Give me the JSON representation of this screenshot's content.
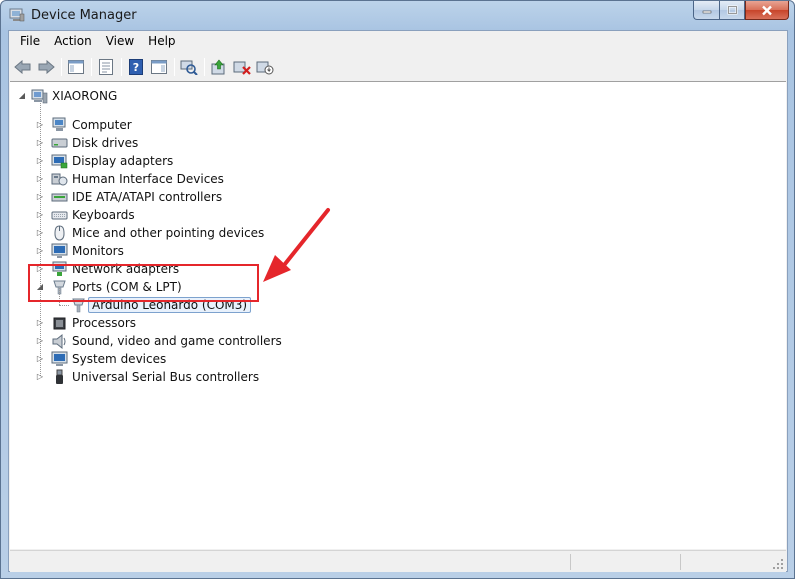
{
  "window": {
    "title": "Device Manager"
  },
  "menu": {
    "file": "File",
    "action": "Action",
    "view": "View",
    "help": "Help"
  },
  "toolbar": {
    "buttons": [
      "back-icon",
      "forward-icon",
      "show-hide-tree-icon",
      "properties-icon",
      "help-icon",
      "action-pane-icon",
      "scan-hardware-icon",
      "update-driver-icon",
      "uninstall-icon",
      "disable-icon"
    ]
  },
  "tree": {
    "root": "XIAORONG",
    "items": [
      {
        "label": "Computer",
        "icon": "computer-icon"
      },
      {
        "label": "Disk drives",
        "icon": "disk-drive-icon"
      },
      {
        "label": "Display adapters",
        "icon": "display-adapter-icon"
      },
      {
        "label": "Human Interface Devices",
        "icon": "hid-icon"
      },
      {
        "label": "IDE ATA/ATAPI controllers",
        "icon": "ide-controller-icon"
      },
      {
        "label": "Keyboards",
        "icon": "keyboard-icon"
      },
      {
        "label": "Mice and other pointing devices",
        "icon": "mouse-icon"
      },
      {
        "label": "Monitors",
        "icon": "monitor-icon"
      },
      {
        "label": "Network adapters",
        "icon": "network-adapter-icon"
      },
      {
        "label": "Ports (COM & LPT)",
        "icon": "port-icon",
        "expanded": true
      },
      {
        "label": "Arduino Leonardo (COM3)",
        "icon": "port-icon",
        "child": true,
        "selected": true
      },
      {
        "label": "Processors",
        "icon": "processor-icon"
      },
      {
        "label": "Sound, video and game controllers",
        "icon": "sound-icon"
      },
      {
        "label": "System devices",
        "icon": "system-devices-icon"
      },
      {
        "label": "Universal Serial Bus controllers",
        "icon": "usb-icon"
      }
    ]
  },
  "colors": {
    "highlight": "#e5262b",
    "selection_border": "#7da2ce"
  }
}
